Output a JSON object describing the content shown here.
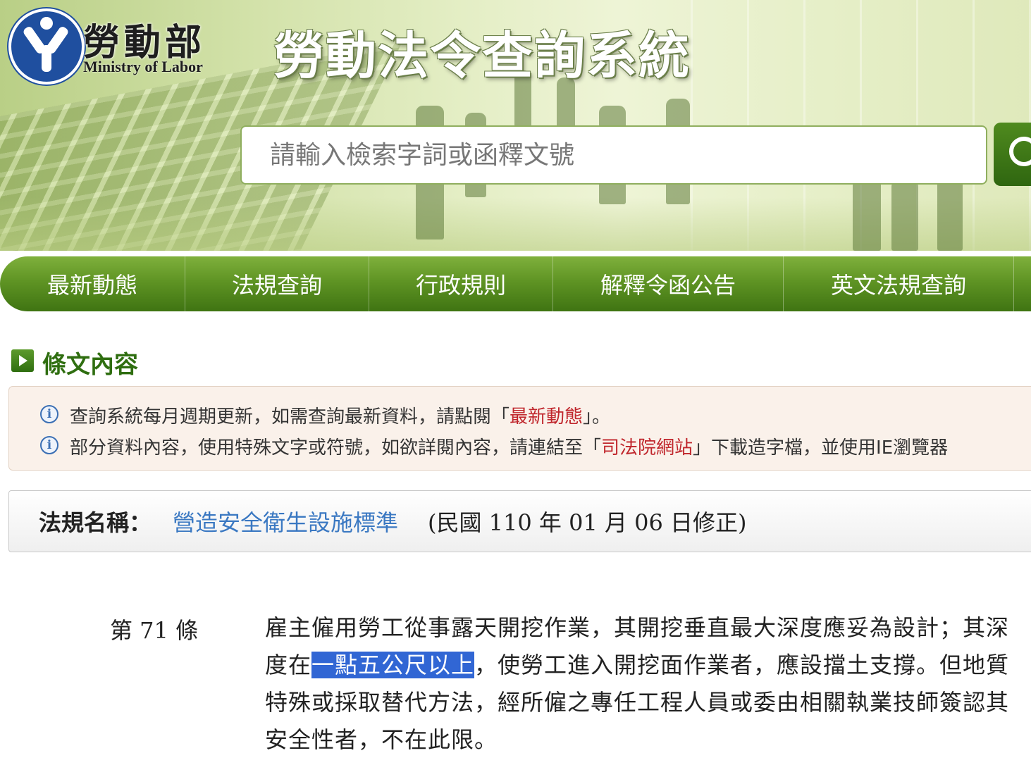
{
  "header": {
    "ministry_name_cn": "勞動部",
    "ministry_name_en": "Ministry of Labor",
    "system_title": "勞動法令查詢系統",
    "search_placeholder": "請輸入檢索字詞或函釋文號"
  },
  "nav": {
    "items": [
      {
        "label": "最新動態"
      },
      {
        "label": "法規查詢"
      },
      {
        "label": "行政規則"
      },
      {
        "label": "解釋令函公告"
      },
      {
        "label": "英文法規查詢"
      }
    ]
  },
  "section": {
    "title": "條文內容"
  },
  "notices": [
    {
      "before": "查詢系統每月週期更新，如需查詢最新資料，請點閱「",
      "link": "最新動態",
      "after": "」。"
    },
    {
      "before": "部分資料內容，使用特殊文字或符號，如欲詳閱內容，請連結至「",
      "link": "司法院網站",
      "after": "」下載造字檔，並使用IE瀏覽器"
    }
  ],
  "law": {
    "label": "法規名稱：",
    "name": "營造安全衛生設施標準",
    "date_text": "(民國 110 年 01 月 06 日修正)"
  },
  "article": {
    "number_text": "第 71 條",
    "line1": "雇主僱用勞工從事露天開挖作業，其開挖垂直最大深度應妥為設計；其深",
    "line2_before": "度在",
    "line2_highlight": "一點五公尺以上",
    "line2_after": "，使勞工進入開挖面作業者，應設擋土支撐。但地質",
    "line3": "特殊或採取替代方法，經所僱之專任工程人員或委由相關執業技師簽認其",
    "line4": "安全性者，不在此限。"
  },
  "colors": {
    "nav_green": "#5f9424",
    "title_green": "#2f6e10",
    "link_blue": "#3a78c2",
    "link_red": "#c0262c",
    "highlight": "#3166d4"
  }
}
